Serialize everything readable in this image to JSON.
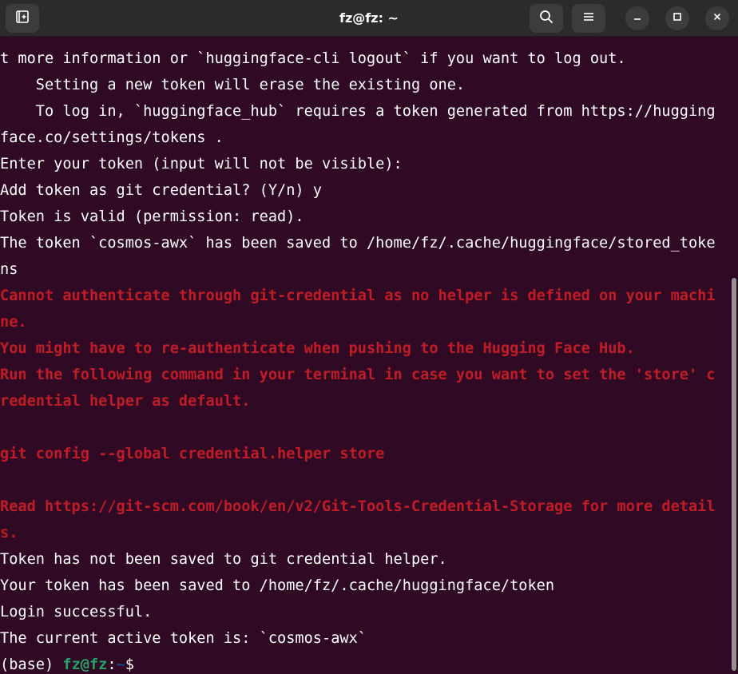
{
  "window": {
    "title": "fz@fz: ~"
  },
  "icons": {
    "new_tab": "new-tab-icon",
    "search": "search-icon",
    "menu": "hamburger-menu-icon",
    "minimize": "minimize-icon",
    "maximize": "maximize-icon",
    "close": "close-icon"
  },
  "colors": {
    "background": "#300a24",
    "text": "#ffffff",
    "error": "#c01c28",
    "prompt_user": "#26a269",
    "prompt_path": "#12488b"
  },
  "terminal": {
    "lines": [
      "t more information or `huggingface-cli logout` if you want to log out.",
      "    Setting a new token will erase the existing one.",
      "    To log in, `huggingface_hub` requires a token generated from https://hugging",
      "face.co/settings/tokens .",
      "Enter your token (input will not be visible):",
      "Add token as git credential? (Y/n) y",
      "Token is valid (permission: read).",
      "The token `cosmos-awx` has been saved to /home/fz/.cache/huggingface/stored_toke",
      "ns",
      "Cannot authenticate through git-credential as no helper is defined on your machi",
      "ne.",
      "You might have to re-authenticate when pushing to the Hugging Face Hub.",
      "Run the following command in your terminal in case you want to set the 'store' c",
      "redential helper as default.",
      "",
      "git config --global credential.helper store",
      "",
      "Read https://git-scm.com/book/en/v2/Git-Tools-Credential-Storage for more detail",
      "s.",
      "Token has not been saved to git credential helper.",
      "Your token has been saved to /home/fz/.cache/huggingface/token",
      "Login successful.",
      "The current active token is: `cosmos-awx`"
    ],
    "prompt": {
      "env": "(base) ",
      "user": "fz@fz",
      "sep": ":",
      "path": "~",
      "symbol": "$"
    }
  }
}
